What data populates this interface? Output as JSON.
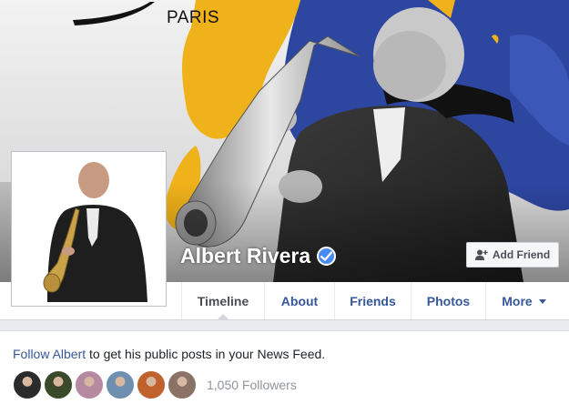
{
  "cover": {
    "brand_text": "PARIS"
  },
  "profile": {
    "name": "Albert Rivera",
    "verified": true
  },
  "actions": {
    "add_friend_label": "Add Friend"
  },
  "tabs": [
    {
      "label": "Timeline",
      "active": true
    },
    {
      "label": "About",
      "active": false
    },
    {
      "label": "Friends",
      "active": false
    },
    {
      "label": "Photos",
      "active": false
    },
    {
      "label": "More",
      "active": false,
      "dropdown": true
    }
  ],
  "follow": {
    "link_text": "Follow Albert",
    "rest_text": " to get his public posts in your News Feed.",
    "follower_count": "1,050 Followers",
    "avatars": [
      {
        "color": "#2b2b2b"
      },
      {
        "color": "#3a4a2a"
      },
      {
        "color": "#b58aa0"
      },
      {
        "color": "#6f8fb0"
      },
      {
        "color": "#c0622e"
      },
      {
        "color": "#8a7366"
      }
    ]
  },
  "colors": {
    "link": "#365899",
    "verified": "#4a8af4",
    "cover_yellow": "#f0b21a",
    "cover_blue": "#2d46a0"
  }
}
